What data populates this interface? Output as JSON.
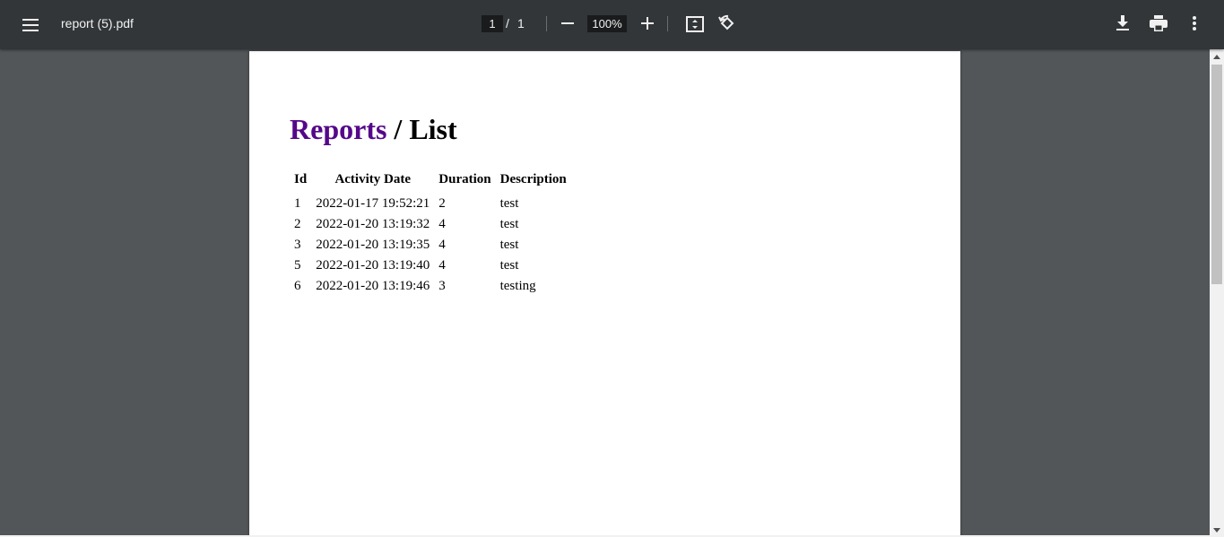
{
  "toolbar": {
    "title": "report (5).pdf",
    "page_current": "1",
    "page_separator": "/",
    "page_total": "1",
    "zoom": "100%",
    "icons": {
      "menu": "hamburger-menu-icon",
      "zoom_out": "minus-icon",
      "zoom_in": "plus-icon",
      "fit": "fit-to-page-icon",
      "rotate": "rotate-counterclockwise-icon",
      "download": "download-icon",
      "print": "print-icon",
      "more": "more-vertical-icon"
    }
  },
  "document": {
    "heading_link": "Reports",
    "heading_separator": " / ",
    "heading_current": "List",
    "table": {
      "headers": [
        "Id",
        "Activity Date",
        "Duration",
        "Description"
      ],
      "rows": [
        [
          "1",
          "2022-01-17 19:52:21",
          "2",
          "test"
        ],
        [
          "2",
          "2022-01-20 13:19:32",
          "4",
          "test"
        ],
        [
          "3",
          "2022-01-20 13:19:35",
          "4",
          "test"
        ],
        [
          "5",
          "2022-01-20 13:19:40",
          "4",
          "test"
        ],
        [
          "6",
          "2022-01-20 13:19:46",
          "3",
          "testing"
        ]
      ]
    }
  },
  "colors": {
    "toolbar_bg": "#323639",
    "viewer_bg": "#525659",
    "heading_link": "#55078a"
  }
}
